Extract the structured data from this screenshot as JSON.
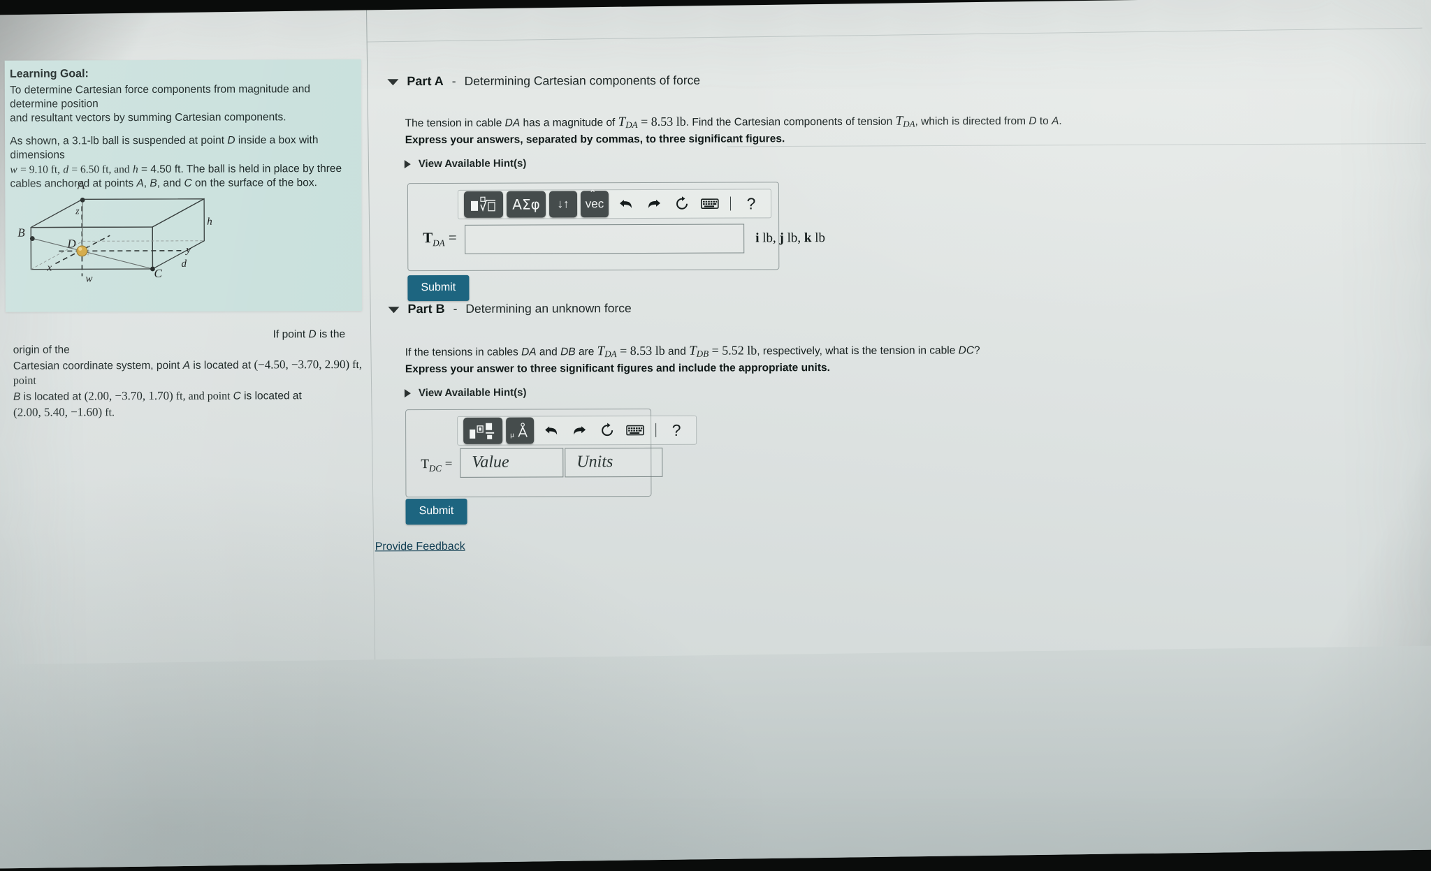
{
  "problem": {
    "goal_title": "Learning Goal:",
    "goal_line1": "To determine Cartesian force components from magnitude and determine position",
    "goal_line2": "and resultant vectors by summing Cartesian components.",
    "setup_line1_a": "As shown, a 3.1-lb ball is suspended at point ",
    "setup_line1_D": "D",
    "setup_line1_b": " inside a box with dimensions",
    "setup_line2": "w = 9.10 ft, d = 6.50 ft, and h = 4.50  ft. The ball is held in place by three",
    "setup_line2_w": "w",
    "setup_line2_w_val": "= 9.10 ft,",
    "setup_line2_d": "d",
    "setup_line2_d_val": "= 6.50 ft, and",
    "setup_line2_h": "h",
    "setup_line2_h_val": "= 4.50  ft. The ball is held in place by three",
    "setup_line3_a": "cables anchored at points ",
    "setup_line3_A": "A",
    "setup_line3_B": "B",
    "setup_line3_C": "C",
    "setup_line3_b": ", and ",
    "setup_line3_c": " on the surface of the box.",
    "closing_a": "If point ",
    "closing_D": "D",
    "closing_b": " is the origin of the",
    "closing_line2_a": "Cartesian coordinate system, point ",
    "closing_line2_A": "A",
    "closing_line2_b": " is located at ",
    "coord_A": "(−4.50, −3.70, 2.90)",
    "closing_line2_c": " ft, point",
    "closing_line3_B": "B",
    "closing_line3_a": " is located at ",
    "coord_B": "(2.00, −3.70, 1.70)",
    "closing_line3_b": " ft, and point ",
    "closing_line3_C": "C",
    "closing_line3_c": " is located at",
    "coord_C": "(2.00, 5.40, −1.60)",
    "closing_line4_b": " ft."
  },
  "diagram": {
    "label_A": "A",
    "label_B": "B",
    "label_C": "C",
    "label_D": "D",
    "label_x": "x",
    "label_y": "y",
    "label_z": "z",
    "label_w": "w",
    "label_d": "d",
    "label_h": "h",
    "ball_color": "#d2a53c"
  },
  "part_a": {
    "label": "Part A",
    "dash": "-",
    "subtitle": "Determining Cartesian components of force",
    "question_a": "The tension in cable ",
    "question_DA": "DA",
    "question_b": " has a magnitude of ",
    "question_T": "T",
    "question_T_sub": "DA",
    "question_eq": " = 8.53 lb",
    "question_c": ". Find the Cartesian components of tension ",
    "question_T2_sub": "DA",
    "question_d": ", which is directed from ",
    "question_D": "D",
    "question_to": " to ",
    "question_A": "A",
    "question_end": ".",
    "instruction": "Express your answers, separated by commas, to three significant figures.",
    "hint_label": "View Available Hint(s)",
    "toolbar": {
      "template_key": "template-sqrt",
      "greek_key": "ΑΣφ",
      "arrows_key": "↓↑",
      "vec_key": "vec",
      "undo": "undo-arrow",
      "redo": "redo-arrow",
      "reset": "reset-circular-arrow",
      "keyboard": "keyboard",
      "help": "?"
    },
    "lhs": "T",
    "lhs_sub": "DA",
    "lhs_eq": "=",
    "input_value": "",
    "units_note": "i lb, j lb, k lb",
    "submit_label": "Submit"
  },
  "part_b": {
    "label": "Part B",
    "dash": "-",
    "subtitle": "Determining an unknown force",
    "question_a": "If the tensions in cables ",
    "question_DA": "DA",
    "question_and": " and ",
    "question_DB": "DB",
    "question_are": " are ",
    "question_T1": "T",
    "question_T1_sub": "DA",
    "question_T1_val": " = 8.53 lb",
    "question_and2": " and ",
    "question_T2": "T",
    "question_T2_sub": "DB",
    "question_T2_val": " = 5.52 lb",
    "question_c": ", respectively, what is the tension in cable ",
    "question_DC": "DC",
    "question_end": "?",
    "instruction": "Express your answer to three significant figures and include the appropriate units.",
    "hint_label": "View Available Hint(s)",
    "toolbar": {
      "template_key": "template-boxes",
      "units_key": "μÅ",
      "undo": "undo-arrow",
      "redo": "redo-arrow",
      "reset": "reset-circular-arrow",
      "keyboard": "keyboard",
      "help": "?"
    },
    "lhs": "T",
    "lhs_sub": "DC",
    "lhs_eq": "=",
    "value_placeholder": "Value",
    "units_placeholder": "Units",
    "submit_label": "Submit"
  },
  "footer": {
    "feedback_label": "Provide Feedback"
  },
  "colors": {
    "submit_teal": "#1d6580",
    "panel_mint": "#c9e0dc",
    "page_bg": "#dde2e1",
    "link": "#0f3d52"
  }
}
